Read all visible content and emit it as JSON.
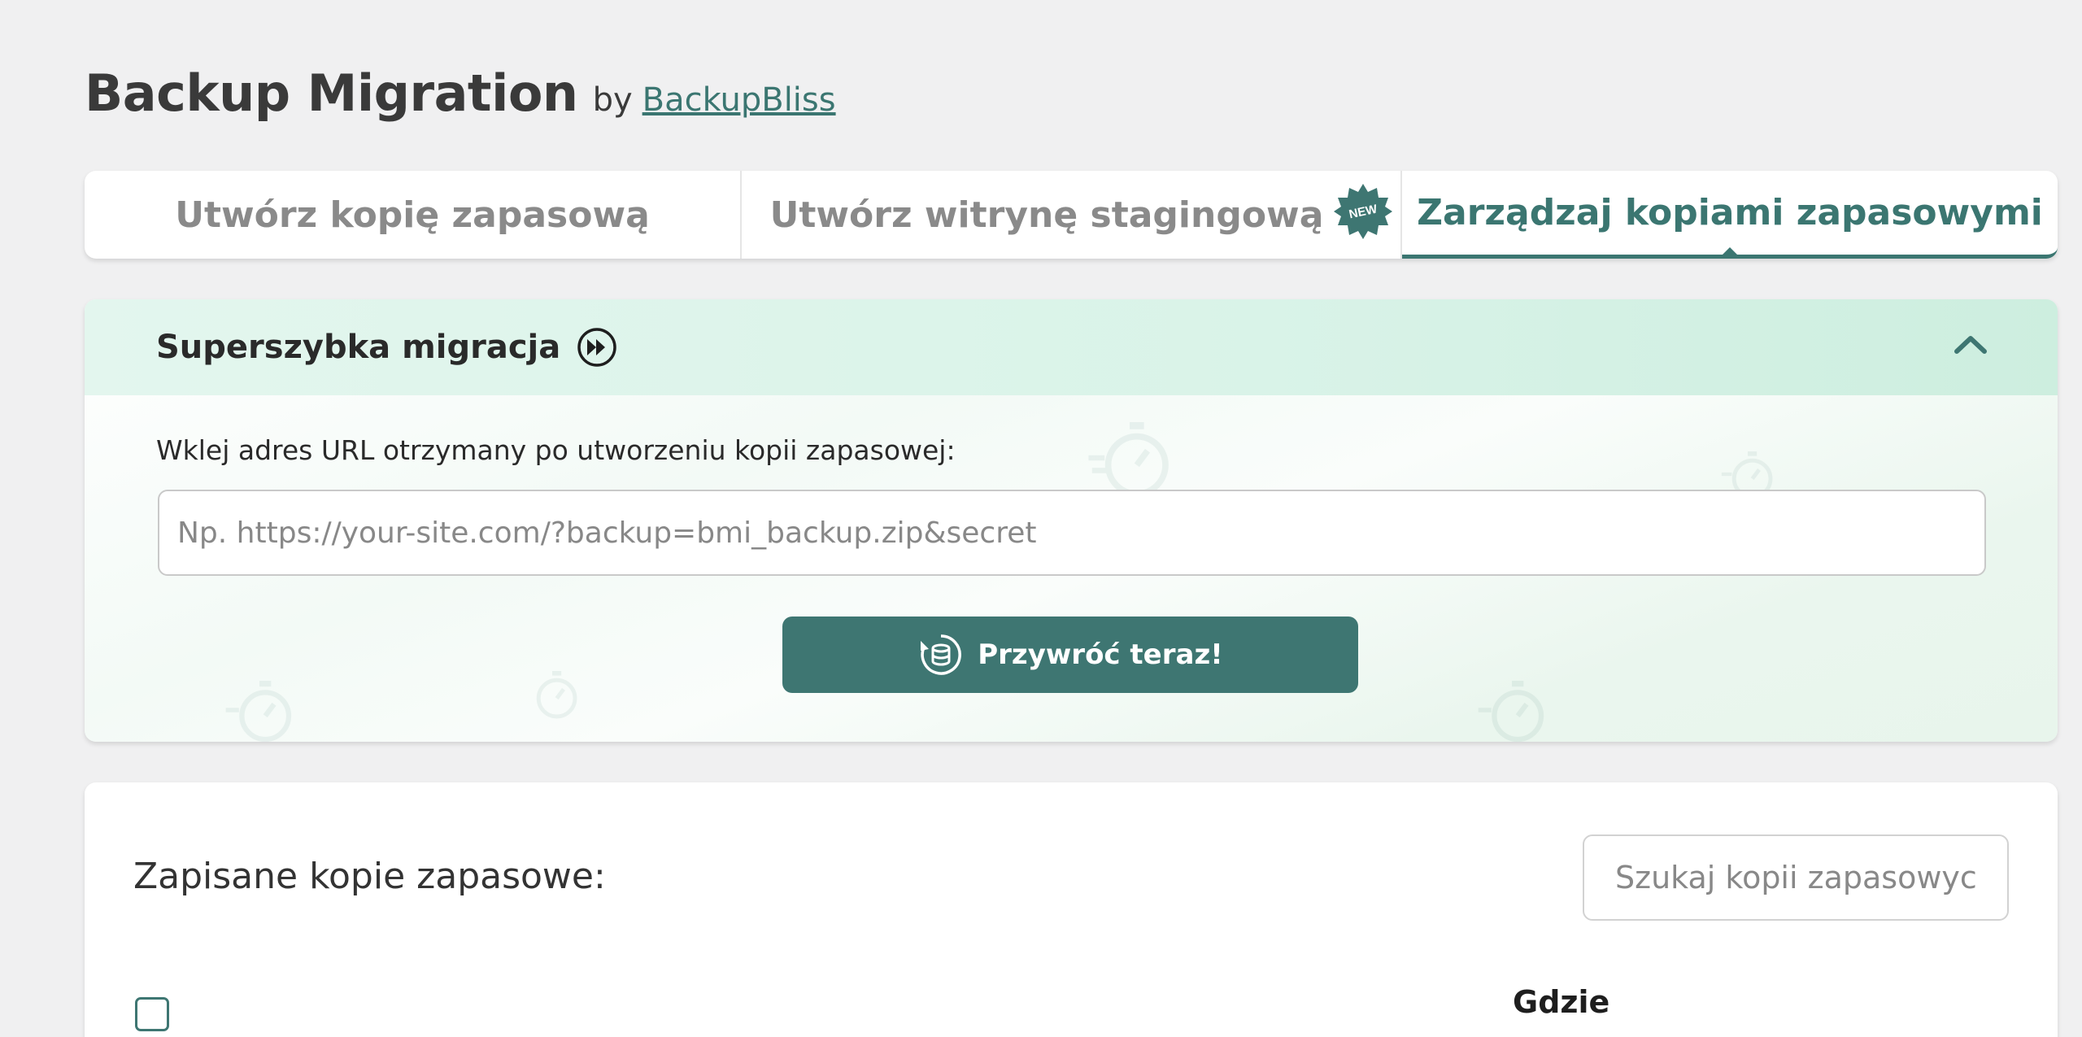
{
  "header": {
    "app_title": "Backup Migration",
    "by_text": "by",
    "vendor_link": "BackupBliss"
  },
  "tabs": [
    {
      "label": "Utwórz kopię zapasową",
      "active": false
    },
    {
      "label": "Utwórz witrynę stagingową",
      "active": false,
      "badge": "NEW"
    },
    {
      "label": "Zarządzaj kopiami zapasowymi",
      "active": true
    }
  ],
  "migration": {
    "title": "Superszybka migracja",
    "url_label": "Wklej adres URL otrzymany po utworzeniu kopii zapasowej:",
    "url_placeholder": "Np. https://your-site.com/?backup=bmi_backup.zip&secret",
    "url_value": "",
    "restore_button": "Przywróć teraz!"
  },
  "saved": {
    "title": "Zapisane kopie zapasowe:",
    "search_placeholder": "Szukaj kopii zapasowych",
    "columns": [
      "Gdzie"
    ]
  },
  "colors": {
    "accent": "#3e7672",
    "accent_text": "#3b7671",
    "panel_head": "#d9f3e8",
    "background": "#f0f0f1"
  }
}
